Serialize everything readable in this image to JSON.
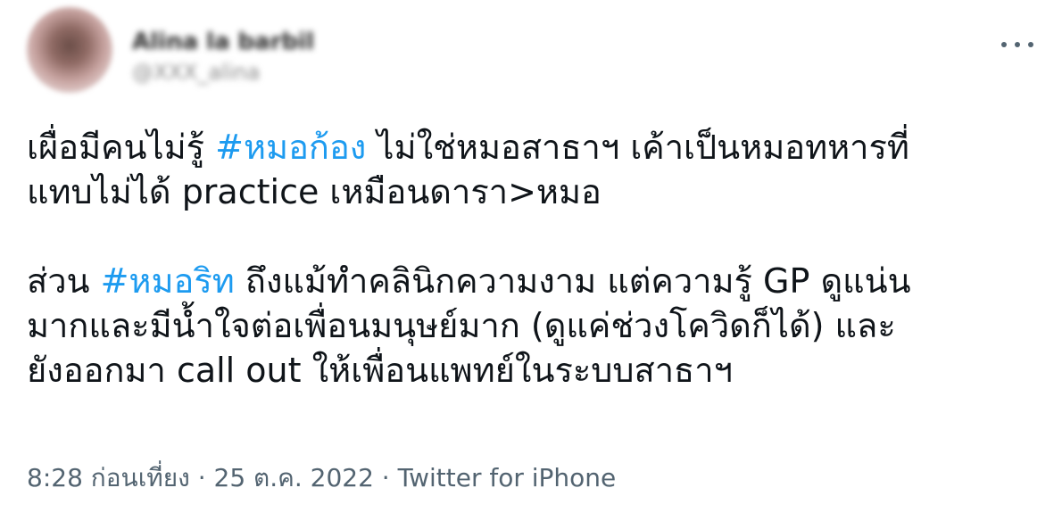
{
  "author": {
    "display_name": "Alina la barbil",
    "handle": "@XXX_alina"
  },
  "tweet": {
    "p1": {
      "before": "เผื่อมีคนไม่รู้ ",
      "hashtag": "#หมอก้อง",
      "after": " ไม่ใช่หมอสาธาฯ เค้าเป็นหมอทหารที่",
      "line2": "แทบไม่ได้ practice เหมือนดารา>หมอ"
    },
    "p2": {
      "before": "ส่วน ",
      "hashtag": "#หมอริท",
      "after": " ถึงแม้ทำคลินิกความงาม แต่ความรู้ GP ดูแน่น",
      "line2": "มากและมีน้ำใจต่อเพื่อนมนุษย์มาก (ดูแค่ช่วงโควิดก็ได้) และ",
      "line3": "ยังออกมา call out ให้เพื่อนแพทย์ในระบบสาธาฯ"
    }
  },
  "meta": {
    "time": "8:28 ก่อนเที่ยง",
    "separator": " · ",
    "date": "25 ต.ค. 2022",
    "source": "Twitter for iPhone"
  },
  "icons": {
    "more": "more-horizontal-icon"
  }
}
